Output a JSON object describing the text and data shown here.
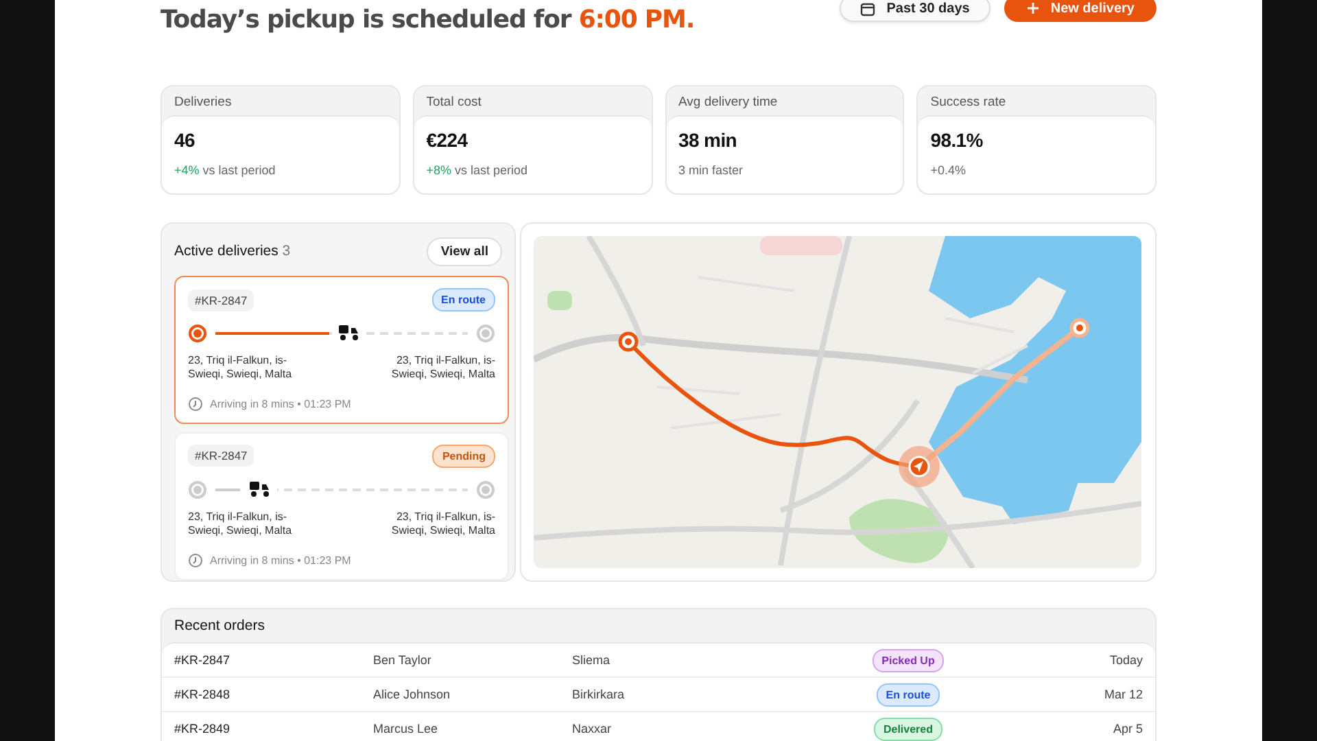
{
  "header": {
    "title": "Today’s pickup is scheduled for",
    "title_time": "6:00 PM.",
    "range_button": "Past 30 days",
    "new_button": "New delivery"
  },
  "stats": [
    {
      "label": "Deliveries",
      "value": "46",
      "change": "+4%",
      "highlight": true,
      "note": "vs last period"
    },
    {
      "label": "Total cost",
      "value": "€224",
      "change": "+8%",
      "highlight": true,
      "note": "vs last period"
    },
    {
      "label": "Avg delivery time",
      "value": "38 min",
      "note": "3 min faster"
    },
    {
      "label": "Success rate",
      "value": "98.1%",
      "change": "+0.4%",
      "highlight": false
    }
  ],
  "active_deliveries": {
    "title": "Active deliveries",
    "count": "3",
    "view_all": "View all",
    "items": [
      {
        "id": "#KR-2847",
        "status": "En route",
        "kind": "en_route",
        "selected": true,
        "started": true,
        "level": 0.45,
        "from": "23, Triq il-Falkun, is-Swieqi, Swieqi, Malta",
        "to": "23, Triq il-Falkun, is-Swieqi, Swieqi, Malta",
        "eta": "Arriving in 8 mins • 01:23 PM"
      },
      {
        "id": "#KR-2847",
        "status": "Pending",
        "kind": "pending",
        "selected": false,
        "started": false,
        "level": 0.1,
        "from": "23, Triq il-Falkun, is-Swieqi, Swieqi, Malta",
        "to": "23, Triq il-Falkun, is-Swieqi, Swieqi, Malta",
        "eta": "Arriving in 8 mins • 01:23 PM"
      }
    ]
  },
  "recent_orders": {
    "title": "Recent orders",
    "rows": [
      {
        "id": "#KR-2847",
        "customer": "Ben Taylor",
        "location": "Sliema",
        "status": "Picked Up",
        "kind": "picked_up",
        "date": "Today"
      },
      {
        "id": "#KR-2848",
        "customer": "Alice Johnson",
        "location": "Birkirkara",
        "status": "En route",
        "kind": "en_route",
        "date": "Mar 12"
      },
      {
        "id": "#KR-2849",
        "customer": "Marcus Lee",
        "location": "Naxxar",
        "status": "Delivered",
        "kind": "delivered",
        "date": "Apr 5"
      }
    ]
  }
}
